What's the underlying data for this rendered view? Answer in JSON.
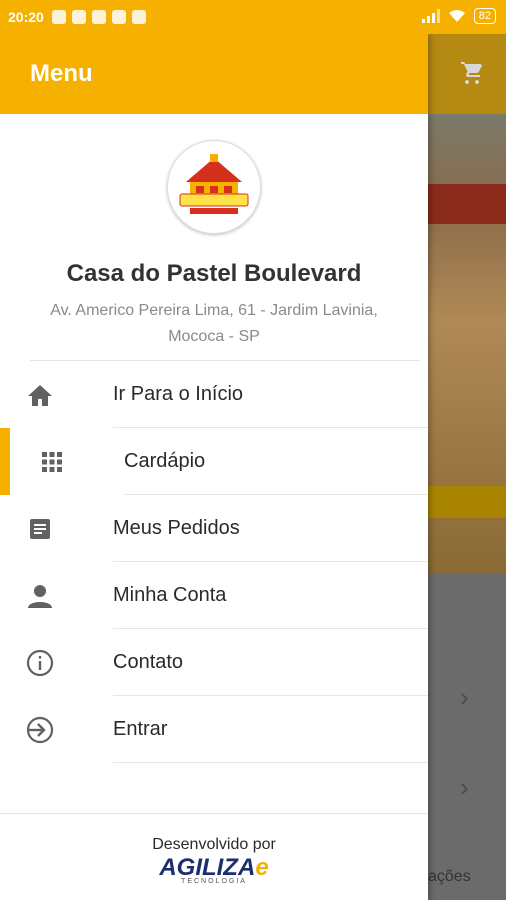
{
  "status_bar": {
    "time": "20:20",
    "battery": "82"
  },
  "drawer": {
    "title": "Menu",
    "store": {
      "name": "Casa do Pastel Boulevard",
      "address": "Av. Americo Pereira Lima, 61 - Jardim Lavinia, Mococa - SP",
      "logo_text": "CASA DO PASTEL"
    },
    "items": [
      {
        "label": "Ir Para o Início",
        "icon": "home-icon",
        "active": false
      },
      {
        "label": "Cardápio",
        "icon": "grid-icon",
        "active": true
      },
      {
        "label": "Meus Pedidos",
        "icon": "document-icon",
        "active": false
      },
      {
        "label": "Minha Conta",
        "icon": "person-icon",
        "active": false
      },
      {
        "label": "Contato",
        "icon": "info-icon",
        "active": false
      },
      {
        "label": "Entrar",
        "icon": "login-icon",
        "active": false
      }
    ],
    "footer": {
      "developed_by": "Desenvolvido por",
      "brand_a": "AGILIZA",
      "brand_b": "e",
      "brand_sub": "TECNOLOGIA"
    }
  },
  "background": {
    "partial_text": "ações"
  },
  "colors": {
    "accent": "#F5B000",
    "text": "#2a2a2a"
  }
}
